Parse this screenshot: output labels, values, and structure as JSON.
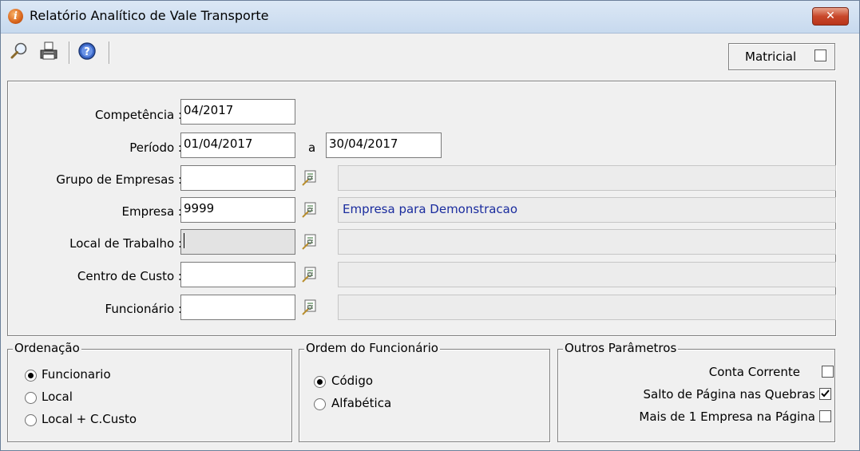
{
  "window": {
    "title": "Relatório Analítico de Vale Transporte",
    "close_label": "✕"
  },
  "toolbar": {
    "buttons": [
      "search-icon",
      "print-icon",
      "help-icon"
    ],
    "matricial_label": "Matricial",
    "matricial_checked": false
  },
  "form": {
    "competencia": {
      "label": "Competência :",
      "value": "04/2017"
    },
    "periodo": {
      "label": "Período :",
      "value_from": "01/04/2017",
      "separator": "a",
      "value_to": "30/04/2017"
    },
    "grupo_empresas": {
      "label": "Grupo de Empresas :",
      "value": "",
      "description": ""
    },
    "empresa": {
      "label": "Empresa :",
      "value": "9999",
      "description": "Empresa para Demonstracao"
    },
    "local_trabalho": {
      "label": "Local de Trabalho :",
      "value": "",
      "description": ""
    },
    "centro_custo": {
      "label": "Centro de Custo :",
      "value": "",
      "description": ""
    },
    "funcionario": {
      "label": "Funcionário :",
      "value": "",
      "description": ""
    }
  },
  "ordenacao": {
    "title": "Ordenação",
    "options": [
      "Funcionario",
      "Local",
      "Local + C.Custo"
    ],
    "selected": "Funcionario"
  },
  "ordem_funcionario": {
    "title": "Ordem do Funcionário",
    "options": [
      "Código",
      "Alfabética"
    ],
    "selected": "Código"
  },
  "outros_parametros": {
    "title": "Outros Parâmetros",
    "items": [
      {
        "label": "Conta Corrente",
        "checked": false
      },
      {
        "label": "Salto de Página nas Quebras",
        "checked": true
      },
      {
        "label": "Mais de 1 Empresa na Página",
        "checked": false
      }
    ]
  },
  "colors": {
    "description_text": "#1a2c9e",
    "background": "#f0f0f0",
    "titlebar": "#c7d9ee",
    "close_button": "#c8472a"
  }
}
